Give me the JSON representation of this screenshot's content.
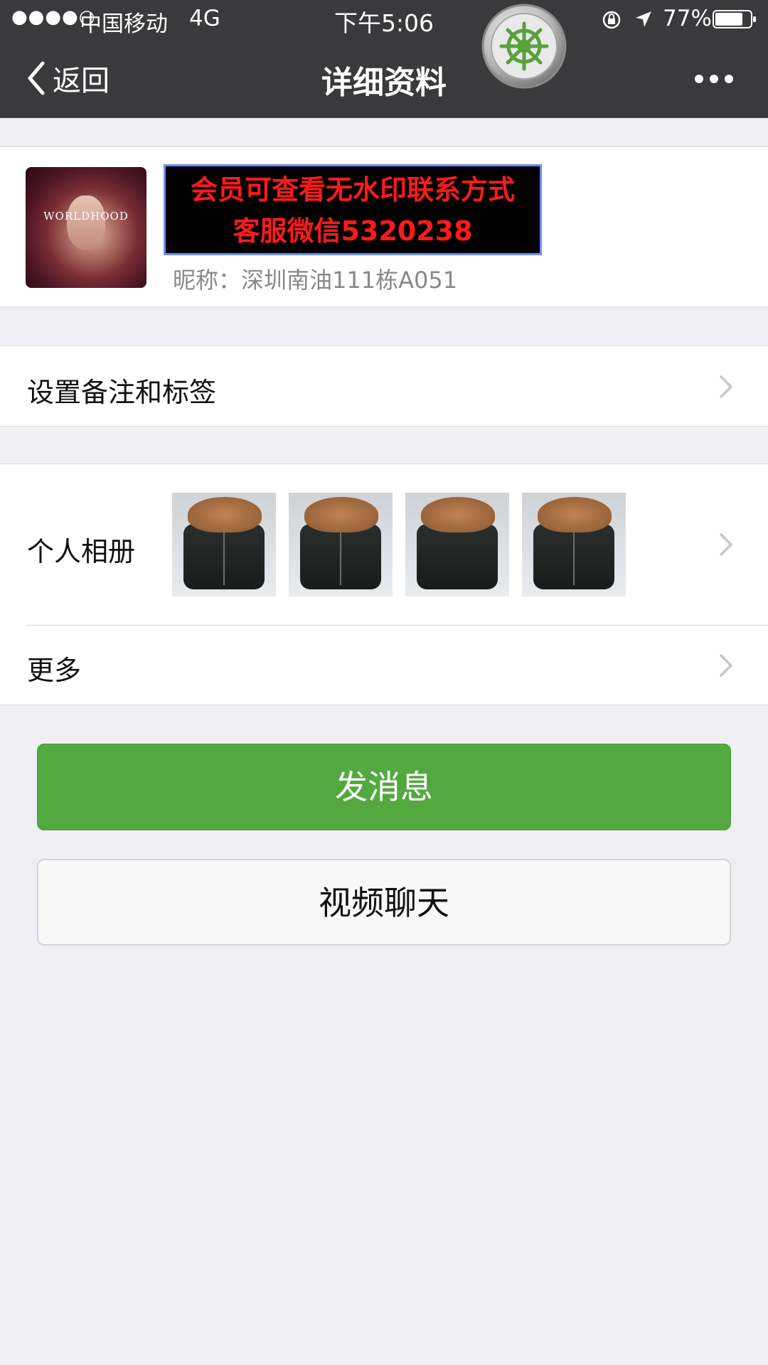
{
  "status_bar": {
    "signal": "●●●●○",
    "carrier": "中国移动",
    "network": "4G",
    "time": "下午5:06",
    "battery": "77%"
  },
  "nav": {
    "back_label": "返回",
    "title": "详细资料"
  },
  "profile": {
    "promo_line1": "会员可查看无水印联系方式",
    "promo_line2": "客服微信5320238",
    "nickname": "昵称：深圳南油111栋A051",
    "avatar_logo": "WORLDHOOD"
  },
  "rows": {
    "remark": "设置备注和标签",
    "album": "个人相册",
    "more": "更多"
  },
  "album": {
    "thumb_count": 4
  },
  "buttons": {
    "send": "发消息",
    "video": "视频聊天"
  },
  "colors": {
    "nav_bg": "#3a3a3d",
    "send_green": "#53a93f",
    "page_bg": "#efeff4",
    "promo_red": "#ff1a1a"
  },
  "icons": [
    "back-chevron-icon",
    "more-dots-icon",
    "helm-icon",
    "lock-rotation-icon",
    "location-arrow-icon",
    "battery-icon",
    "chevron-right-icon"
  ]
}
